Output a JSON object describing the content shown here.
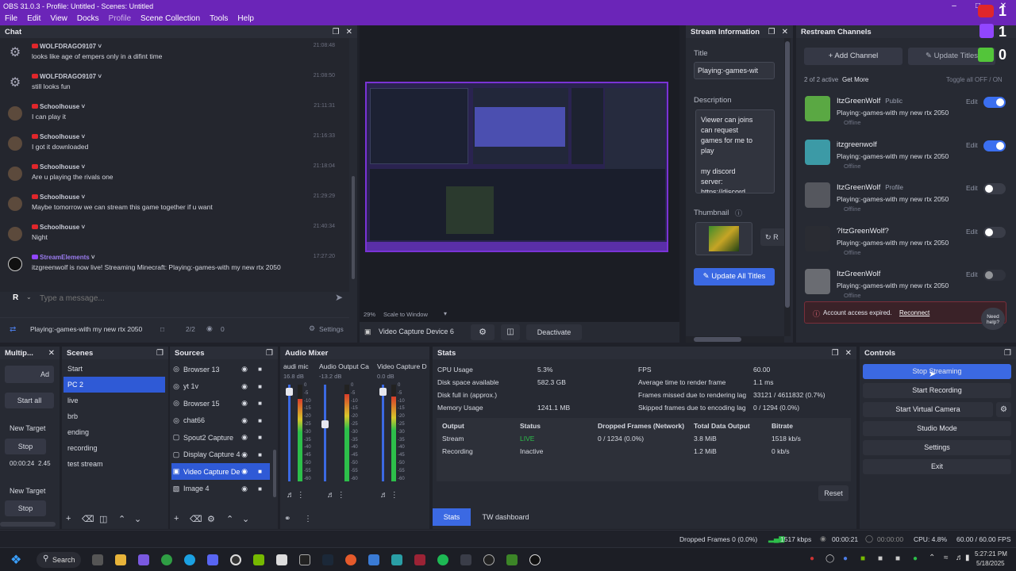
{
  "window": {
    "title": "OBS 31.0.3 - Profile: Untitled - Scenes: Untitled"
  },
  "menu": [
    "File",
    "Edit",
    "View",
    "Docks",
    "Profile",
    "Scene Collection",
    "Tools",
    "Help"
  ],
  "chat": {
    "title": "Chat",
    "messages": [
      {
        "user": "WOLFDRAGO9107",
        "time": "21:08:48",
        "text": "looks like age of empers only in a difint time",
        "platform": "yt",
        "avatar": "gear"
      },
      {
        "user": "WOLFDRAGO9107",
        "time": "21:08:50",
        "text": "still looks fun",
        "platform": "yt",
        "avatar": "gear"
      },
      {
        "user": "Schoolhouse",
        "time": "21:11:31",
        "text": "I can play it",
        "platform": "yt",
        "avatar": "person"
      },
      {
        "user": "Schoolhouse",
        "time": "21:16:33",
        "text": "I got it downloaded",
        "platform": "yt",
        "avatar": "person"
      },
      {
        "user": "Schoolhouse",
        "time": "21:18:04",
        "text": "Are u playing the rivals one",
        "platform": "yt",
        "avatar": "person"
      },
      {
        "user": "Schoolhouse",
        "time": "21:29:29",
        "text": "Maybe tomorrow we can stream this game together if u want",
        "platform": "yt",
        "avatar": "person"
      },
      {
        "user": "Schoolhouse",
        "time": "21:40:34",
        "text": "Night",
        "platform": "yt",
        "avatar": "person"
      },
      {
        "user": "StreamElements",
        "time": "17:27:20",
        "text": "itzgreenwolf is now live! Streaming Minecraft: Playing:-games-with my new rtx 2050",
        "platform": "tw",
        "avatar": "se"
      }
    ],
    "input_placeholder": "Type a message...",
    "avatar_letter": "R",
    "footer_title": "Playing:-games-with my new rtx 2050",
    "footer_count": "2/2",
    "footer_viewers": "0",
    "footer_settings": "Settings"
  },
  "preview": {
    "zoom": "29%",
    "scale_mode": "Scale to Window",
    "source_name": "Video Capture Device 6",
    "deactivate": "Deactivate"
  },
  "stream_info": {
    "title": "Stream Information",
    "title_label": "Title",
    "title_value": "Playing:-games-wit",
    "desc_label": "Description",
    "desc_lines": [
      "Viewer can joins",
      "can request",
      "games for me to",
      "play",
      "",
      "my discord",
      "server:",
      "https://discord"
    ],
    "thumb_label": "Thumbnail",
    "thumb_btn": "R",
    "update_btn": "Update All Titles"
  },
  "restream": {
    "title": "Restream Channels",
    "add_btn": "Add Channel",
    "update_btn": "Update Titles",
    "active": "2 of 2 active",
    "get_more": "Get More",
    "toggle_all": "Toggle all OFF / ON",
    "edit": "Edit",
    "channels": [
      {
        "name": "ItzGreenWolf",
        "tag": "Public",
        "title": "Playing:-games-with my new rtx 2050",
        "status": "Offline",
        "toggle": "on",
        "color": "#5aa843"
      },
      {
        "name": "itzgreenwolf",
        "tag": "",
        "title": "Playing:-games-with my new rtx 2050",
        "status": "Offline",
        "toggle": "on",
        "color": "#3c9aa6"
      },
      {
        "name": "ItzGreenWolf",
        "tag": "Profile",
        "title": "Playing:-games-with my new rtx 2050",
        "status": "Offline",
        "toggle": "off",
        "color": "#55575e"
      },
      {
        "name": "?ItzGreenWolf?",
        "tag": "",
        "title": "Playing:-games-with my new rtx 2050",
        "status": "Offline",
        "toggle": "off",
        "color": "#2a2c33"
      },
      {
        "name": "ItzGreenWolf",
        "tag": "",
        "title": "Playing:-games-with my new rtx 2050",
        "status": "Offline",
        "toggle": "dis",
        "color": "#6a6c72"
      }
    ],
    "expired": "Account access expired.",
    "reconnect": "Reconnect",
    "help": "Need help?"
  },
  "overlay": {
    "yt_count": "1",
    "tw_count": "1",
    "k_count": "0"
  },
  "multiplatform": {
    "title": "Multip...",
    "add": "Ad",
    "start_all": "Start all",
    "target1": "New Target",
    "stop1": "Stop",
    "time1": "00:00:24",
    "rate1": "2.45",
    "target2": "New Target",
    "stop2": "Stop"
  },
  "scenes": {
    "title": "Scenes",
    "items": [
      "Start",
      "PC 2",
      "live",
      "brb",
      "ending",
      "recording",
      "test stream"
    ],
    "selected": 1
  },
  "sources": {
    "title": "Sources",
    "items": [
      "Browser 13",
      "yt 1v",
      "Browser 15",
      "chat66",
      "Spout2 Capture",
      "Display Capture 4",
      "Video Capture De",
      "Image 4"
    ],
    "selected": 6
  },
  "mixer": {
    "title": "Audio Mixer",
    "channels": [
      {
        "name": "audi mic",
        "db": "16.8 dB"
      },
      {
        "name": "Audio Output Ca",
        "db": "-13.2 dB"
      },
      {
        "name": "Video Capture D",
        "db": "0.0 dB"
      }
    ],
    "scale": [
      "0",
      "-5",
      "-10",
      "-15",
      "-20",
      "-25",
      "-30",
      "-35",
      "-40",
      "-45",
      "-50",
      "-55",
      "-60"
    ]
  },
  "stats": {
    "title": "Stats",
    "left": [
      [
        "CPU Usage",
        "5.3%"
      ],
      [
        "Disk space available",
        "582.3 GB"
      ],
      [
        "Disk full in (approx.)",
        ""
      ],
      [
        "Memory Usage",
        "1241.1 MB"
      ]
    ],
    "right": [
      [
        "FPS",
        "60.00"
      ],
      [
        "Average time to render frame",
        "1.1 ms"
      ],
      [
        "Frames missed due to rendering lag",
        "33121 / 4611832 (0.7%)"
      ],
      [
        "Skipped frames due to encoding lag",
        "0 / 1294 (0.0%)"
      ]
    ],
    "table_headers": [
      "Output",
      "Status",
      "Dropped Frames (Network)",
      "Total Data Output",
      "Bitrate"
    ],
    "rows": [
      [
        "Stream",
        "LIVE",
        "0 / 1234 (0.0%)",
        "3.8 MiB",
        "1518 kb/s"
      ],
      [
        "Recording",
        "Inactive",
        "",
        "1.2 MiB",
        "0 kb/s"
      ]
    ],
    "reset": "Reset",
    "tab_stats": "Stats",
    "tab_tw": "TW dashboard"
  },
  "controls": {
    "title": "Controls",
    "buttons": [
      "Stop Streaming",
      "Start Recording",
      "Start Virtual Camera",
      "Studio Mode",
      "Settings",
      "Exit"
    ]
  },
  "statusbar": {
    "dropped": "Dropped Frames 0 (0.0%)",
    "kbps": "1517 kbps",
    "stream_time": "00:00:21",
    "rec_time": "00:00:00",
    "cpu": "CPU: 4.8%",
    "fps": "60.00 / 60.00 FPS"
  },
  "taskbar": {
    "search": "Search",
    "time": "5:27:21 PM",
    "date": "5/18/2025"
  }
}
